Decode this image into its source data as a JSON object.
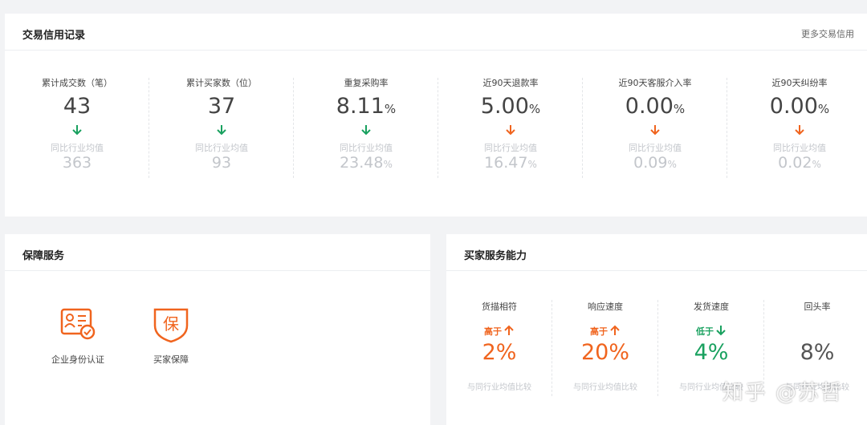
{
  "credit": {
    "title": "交易信用记录",
    "more_link": "更多交易信用",
    "compare_label": "同比行业均值",
    "stats": [
      {
        "label": "累计成交数（笔）",
        "value": "43",
        "unit": "",
        "trend": "down",
        "trend_color": "#19a15f",
        "industry": "363",
        "industry_unit": ""
      },
      {
        "label": "累计买家数（位）",
        "value": "37",
        "unit": "",
        "trend": "down",
        "trend_color": "#19a15f",
        "industry": "93",
        "industry_unit": ""
      },
      {
        "label": "重复采购率",
        "value": "8.11",
        "unit": "%",
        "trend": "down",
        "trend_color": "#19a15f",
        "industry": "23.48",
        "industry_unit": "%"
      },
      {
        "label": "近90天退款率",
        "value": "5.00",
        "unit": "%",
        "trend": "down",
        "trend_color": "#f0641e",
        "industry": "16.47",
        "industry_unit": "%"
      },
      {
        "label": "近90天客服介入率",
        "value": "0.00",
        "unit": "%",
        "trend": "down",
        "trend_color": "#f0641e",
        "industry": "0.09",
        "industry_unit": "%"
      },
      {
        "label": "近90天纠纷率",
        "value": "0.00",
        "unit": "%",
        "trend": "down",
        "trend_color": "#f0641e",
        "industry": "0.02",
        "industry_unit": "%"
      }
    ]
  },
  "guarantee": {
    "title": "保障服务",
    "items": [
      {
        "name": "企业身份认证",
        "icon": "id-card-check-icon"
      },
      {
        "name": "买家保障",
        "icon": "shield-bao-icon",
        "glyph": "保"
      }
    ]
  },
  "ability": {
    "title": "买家服务能力",
    "note": "与同行业均值比较",
    "items": [
      {
        "label": "货描相符",
        "direction": "高于",
        "arrow": "up",
        "value": "2%",
        "color": "orange"
      },
      {
        "label": "响应速度",
        "direction": "高于",
        "arrow": "up",
        "value": "20%",
        "color": "orange"
      },
      {
        "label": "发货速度",
        "direction": "低于",
        "arrow": "down",
        "value": "4%",
        "color": "green"
      },
      {
        "label": "回头率",
        "direction": "",
        "arrow": "",
        "value": "8%",
        "color": "gray"
      }
    ]
  },
  "watermark": "知乎 @苏哲",
  "colors": {
    "orange": "#f0641e",
    "green": "#19a15f",
    "muted": "#c3c6cb"
  }
}
